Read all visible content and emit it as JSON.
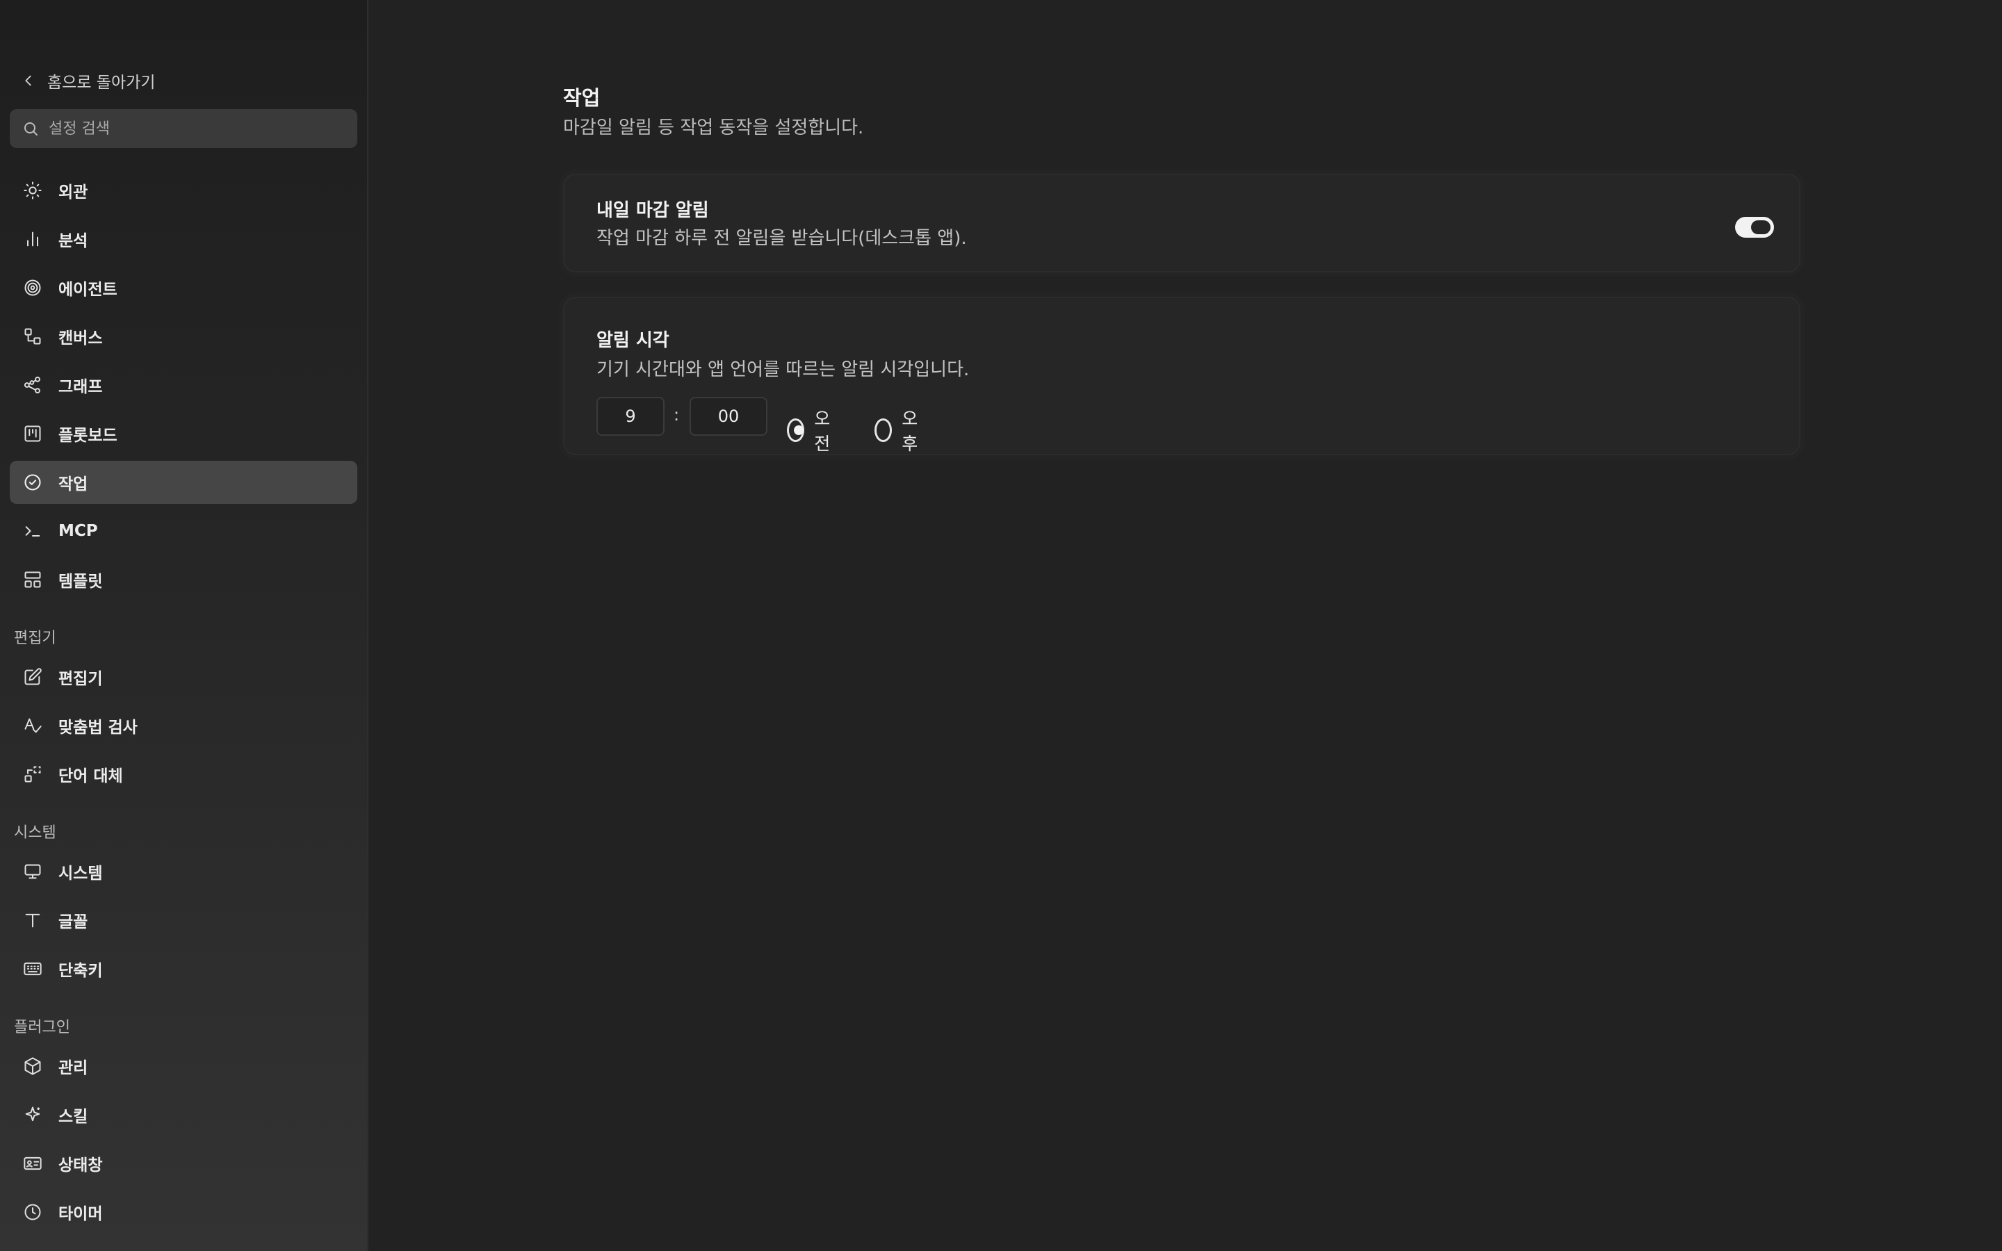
{
  "sidebar": {
    "back_label": "홈으로 돌아가기",
    "search_placeholder": "설정 검색",
    "items": [
      {
        "label": "외관",
        "icon": "sun-icon"
      },
      {
        "label": "분석",
        "icon": "bar-chart-icon"
      },
      {
        "label": "에이전트",
        "icon": "spiral-icon"
      },
      {
        "label": "캔버스",
        "icon": "canvas-icon"
      },
      {
        "label": "그래프",
        "icon": "graph-icon"
      },
      {
        "label": "플롯보드",
        "icon": "kanban-icon"
      },
      {
        "label": "작업",
        "icon": "check-circle-icon",
        "active": true
      },
      {
        "label": "MCP",
        "icon": "terminal-icon"
      },
      {
        "label": "템플릿",
        "icon": "template-icon"
      }
    ],
    "sections": [
      {
        "title": "편집기",
        "items": [
          {
            "label": "편집기",
            "icon": "edit-icon"
          },
          {
            "label": "맞춤법 검사",
            "icon": "spellcheck-icon"
          },
          {
            "label": "단어 대체",
            "icon": "replace-icon"
          }
        ]
      },
      {
        "title": "시스템",
        "items": [
          {
            "label": "시스템",
            "icon": "monitor-icon"
          },
          {
            "label": "글꼴",
            "icon": "type-icon"
          },
          {
            "label": "단축키",
            "icon": "keyboard-icon"
          }
        ]
      },
      {
        "title": "플러그인",
        "items": [
          {
            "label": "관리",
            "icon": "package-icon"
          },
          {
            "label": "스킬",
            "icon": "sparkle-icon"
          },
          {
            "label": "상태창",
            "icon": "id-card-icon"
          },
          {
            "label": "타이머",
            "icon": "clock-icon"
          }
        ]
      }
    ]
  },
  "main": {
    "title": "작업",
    "subtitle": "마감일 알림 등 작업 동작을 설정합니다.",
    "deadline_card": {
      "title": "내일 마감 알림",
      "description": "작업 마감 하루 전 알림을 받습니다(데스크톱 앱).",
      "toggle_on": true
    },
    "time_card": {
      "title": "알림 시각",
      "description": "기기 시간대와 앱 언어를 따르는 알림 시각입니다.",
      "hour": "9",
      "separator": ":",
      "minute": "00",
      "am_label": "오전",
      "pm_label": "오후",
      "selected": "am"
    }
  },
  "colors": {
    "background": "#222222",
    "sidebar_active": "#464646",
    "text": "#ececec",
    "muted_text": "#bcbcbc"
  }
}
